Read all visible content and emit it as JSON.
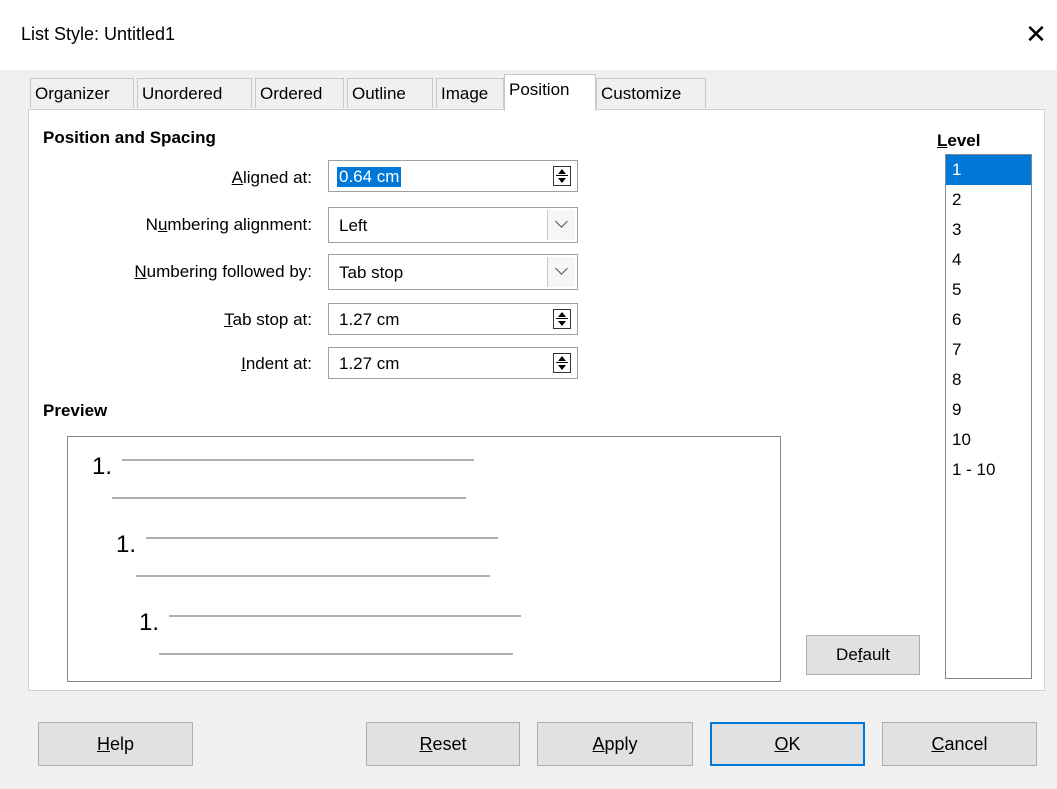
{
  "window": {
    "title": "List Style: Untitled1",
    "close_glyph": "✕"
  },
  "tabs": [
    {
      "label": "Organizer",
      "active": false
    },
    {
      "label": "Unordered",
      "active": false
    },
    {
      "label": "Ordered",
      "active": false
    },
    {
      "label": "Outline",
      "active": false
    },
    {
      "label": "Image",
      "active": false
    },
    {
      "label": "Position",
      "active": true
    },
    {
      "label": "Customize",
      "active": false
    }
  ],
  "position_spacing": {
    "heading": "Position and Spacing",
    "aligned_at": {
      "label_pre": "",
      "label_u": "A",
      "label_post": "ligned at:",
      "value": "0.64 cm"
    },
    "numbering_alignment": {
      "label_pre": "N",
      "label_u": "u",
      "label_post": "mbering alignment:",
      "value": "Left"
    },
    "numbering_followed_by": {
      "label_pre": "",
      "label_u": "N",
      "label_post": "umbering followed by:",
      "value": "Tab stop"
    },
    "tab_stop_at": {
      "label_pre": "",
      "label_u": "T",
      "label_post": "ab stop at:",
      "value": "1.27 cm"
    },
    "indent_at": {
      "label_pre": "",
      "label_u": "I",
      "label_post": "ndent at:",
      "value": "1.27 cm"
    }
  },
  "preview": {
    "heading": "Preview",
    "numbers": [
      "1.",
      "1.",
      "1."
    ]
  },
  "default_button": {
    "label_pre": "De",
    "label_u": "f",
    "label_post": "ault"
  },
  "level": {
    "label_u": "L",
    "label_post": "evel",
    "items": [
      "1",
      "2",
      "3",
      "4",
      "5",
      "6",
      "7",
      "8",
      "9",
      "10",
      "1 - 10"
    ],
    "selected_index": 0
  },
  "buttons": {
    "help": {
      "label_u": "H",
      "label_post": "elp"
    },
    "reset": {
      "label_u": "R",
      "label_post": "eset"
    },
    "apply": {
      "label_u": "A",
      "label_post": "pply"
    },
    "ok": {
      "label_u": "O",
      "label_post": "K"
    },
    "cancel": {
      "label_u": "C",
      "label_post": "ancel"
    }
  }
}
